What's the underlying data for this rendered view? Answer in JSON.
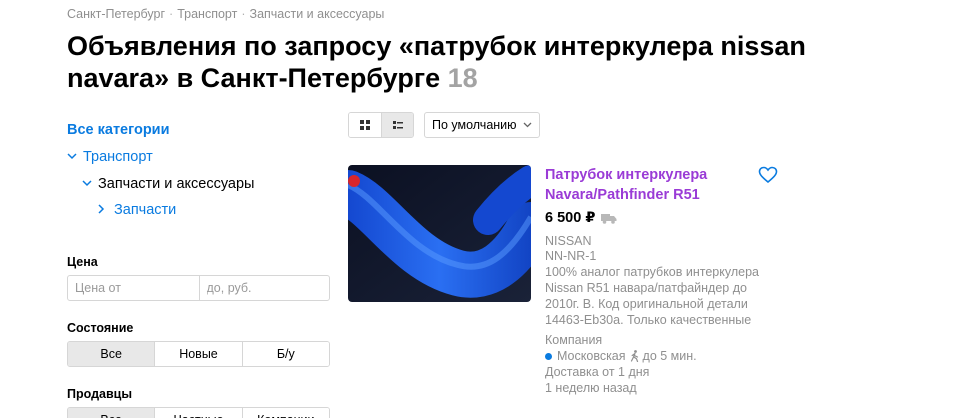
{
  "breadcrumb": [
    "Санкт-Петербург",
    "Транспорт",
    "Запчасти и аксессуары"
  ],
  "header": {
    "title": "Объявления по запросу «патрубок интеркулера nissan navara» в Санкт-Петербурге",
    "count": "18"
  },
  "sidebar": {
    "all_categories": "Все категории",
    "transport": "Транспорт",
    "parts_accessories": "Запчасти и аксессуары",
    "parts": "Запчасти",
    "price_label": "Цена",
    "price_from_placeholder": "Цена от",
    "price_to_placeholder": "до, руб.",
    "condition_label": "Состояние",
    "condition_options": [
      "Все",
      "Новые",
      "Б/у"
    ],
    "condition_selected": 0,
    "sellers_label": "Продавцы",
    "sellers_options": [
      "Все",
      "Частные",
      "Компании"
    ],
    "sellers_selected": 0
  },
  "toolbar": {
    "view_mode": "list",
    "sort_value": "По умолчанию"
  },
  "listing": {
    "title": "Патрубок интеркулера Navara/Pathfinder R51",
    "price": "6 500 ₽",
    "brand": "NISSAN",
    "code": "NN-NR-1",
    "description": "100% аналог патрубков интеркулера Nissan R51 навара/патфайндер до 2010г. В. Код оригинальной детали 14463-Eb30a. Только качественные",
    "seller_type": "Компания",
    "metro": "Московская",
    "walk_time": "до 5 мин.",
    "delivery": "Доставка от 1 дня",
    "posted": "1 неделю назад"
  },
  "colors": {
    "link_blue": "#0a7be0",
    "title_purple": "#9a3bd6",
    "muted_gray": "#8f8f8f",
    "thumb_blue": "#1f5fe0"
  }
}
